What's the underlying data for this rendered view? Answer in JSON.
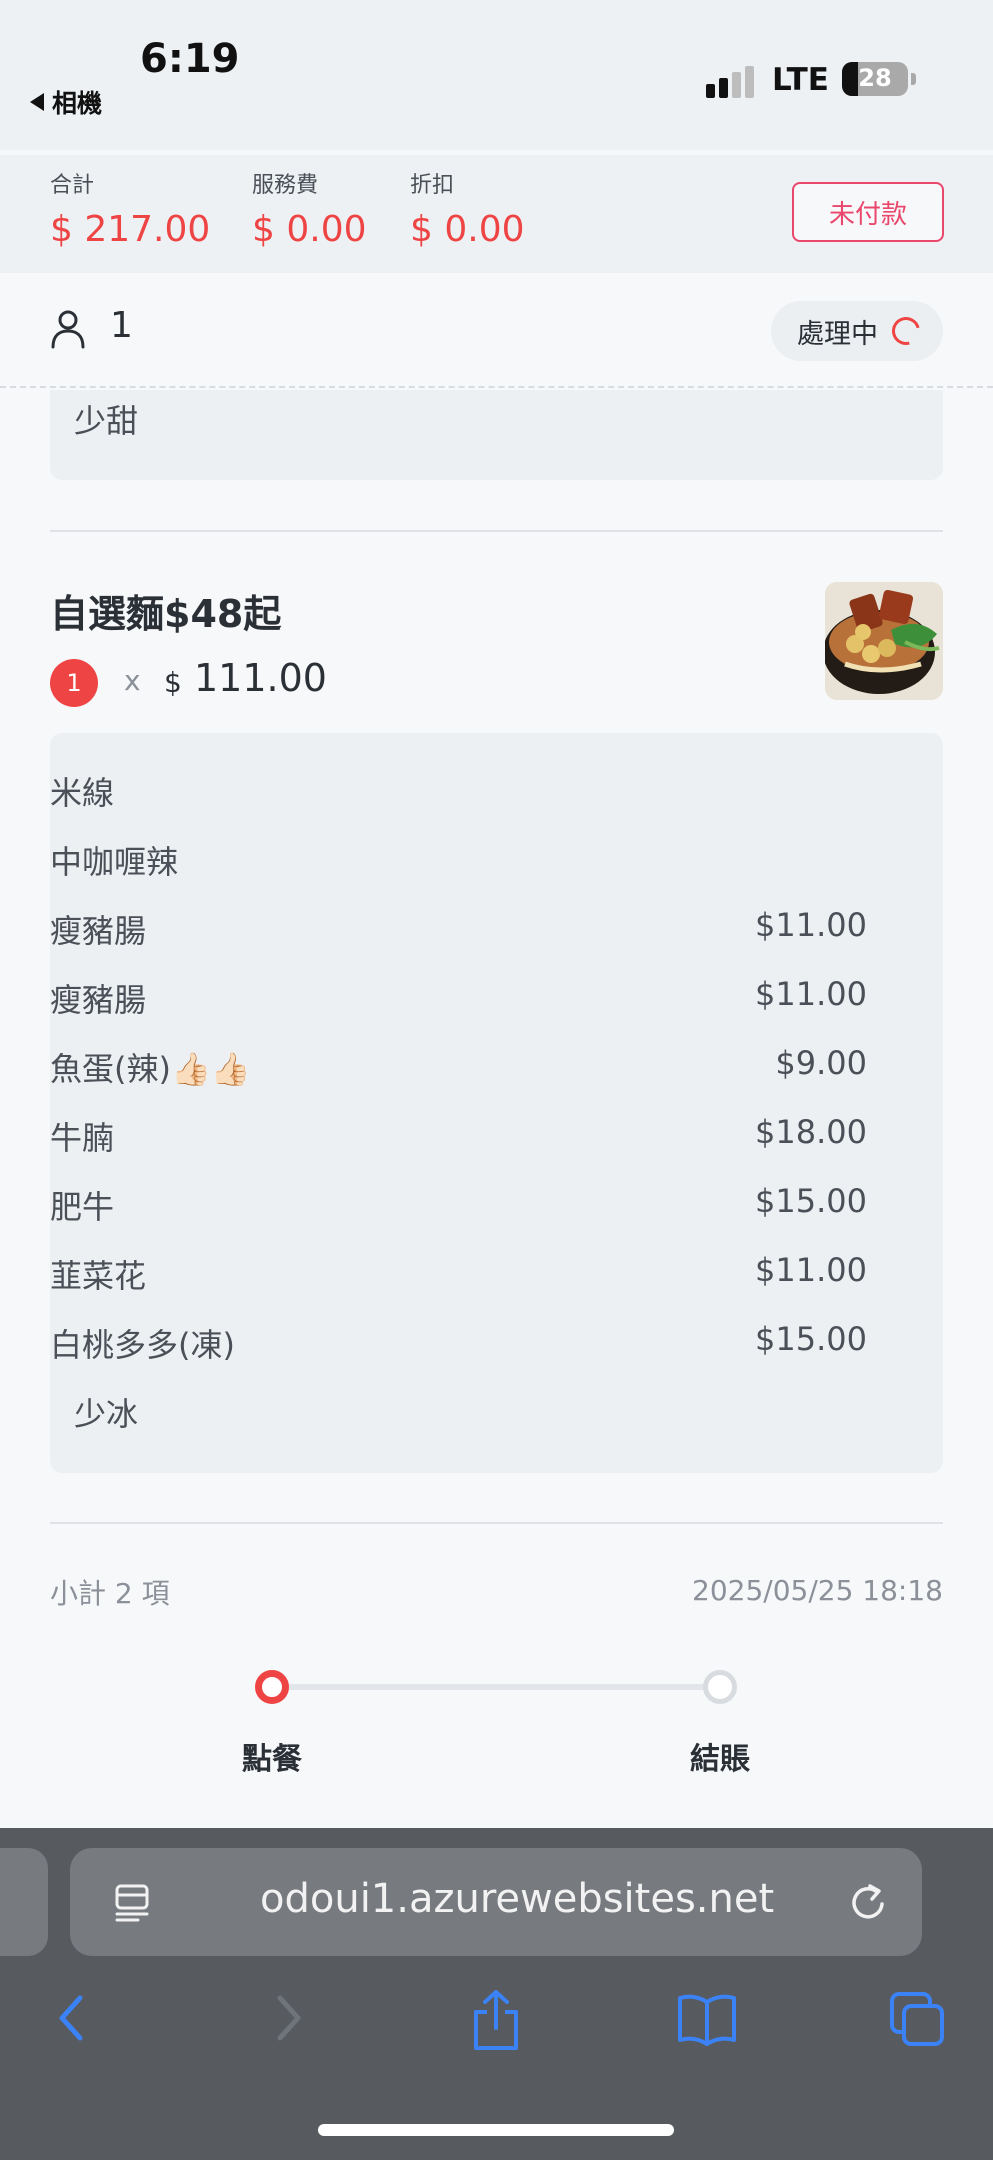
{
  "status_bar": {
    "time": "6:19",
    "back_label": "相機",
    "network": "LTE",
    "battery": "28"
  },
  "summary": {
    "total_label": "合計",
    "total_value": "$ 217.00",
    "service_label": "服務費",
    "service_value": "$ 0.00",
    "discount_label": "折扣",
    "discount_value": "$ 0.00",
    "payment_status": "未付款"
  },
  "guest": {
    "count": "1",
    "status": "處理中"
  },
  "previous_item": {
    "options": [
      {
        "name": "少甜",
        "price": ""
      }
    ]
  },
  "item": {
    "title": "自選麵$48起",
    "quantity": "1",
    "times": "x",
    "currency": "$",
    "price": "111.00",
    "options": [
      {
        "name": "米線",
        "price": ""
      },
      {
        "name": "中咖喱辣",
        "price": ""
      },
      {
        "name": "瘦豬腸",
        "price": "$11.00"
      },
      {
        "name": "瘦豬腸",
        "price": "$11.00"
      },
      {
        "name": "魚蛋(辣)👍🏻👍🏻",
        "price": "$9.00"
      },
      {
        "name": "牛腩",
        "price": "$18.00"
      },
      {
        "name": "肥牛",
        "price": "$15.00"
      },
      {
        "name": "韮菜花",
        "price": "$11.00"
      },
      {
        "name": "白桃多多(凍)",
        "price": "$15.00"
      },
      {
        "name": "少冰",
        "price": ""
      }
    ]
  },
  "footer": {
    "subtotal": "小計 2 項",
    "timestamp": "2025/05/25 18:18",
    "steps": [
      "點餐",
      "結賬"
    ]
  },
  "browser": {
    "url": "odoui1.azurewebsites.net"
  },
  "colors": {
    "accent_red": "#ef4444",
    "unpaid_pink": "#e9476b",
    "browser_bar": "#575b60",
    "ios_blue": "#3b82f6"
  }
}
